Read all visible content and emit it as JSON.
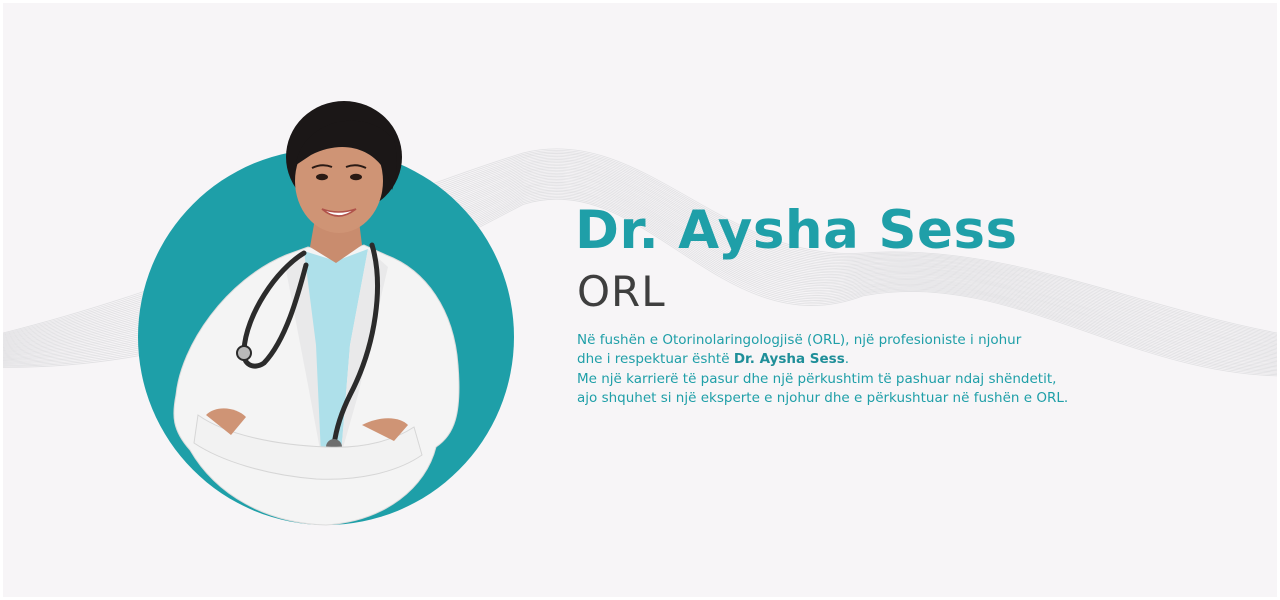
{
  "colors": {
    "accent": "#1f9fa8",
    "circle": "#1e9fa8",
    "specialty_text": "#3f3f3f",
    "background": "#f7f5f7"
  },
  "profile": {
    "name": "Dr. Aysha Sess",
    "specialty": "ORL",
    "photo_alt": "doctor-portrait"
  },
  "bio": {
    "line1": "Në fushën e Otorinolaringologjisë (ORL), një profesioniste i njohur",
    "line2_prefix": "dhe i respektuar është ",
    "line2_bold": "Dr. Aysha Sess",
    "line2_suffix": ".",
    "line3": "Me një karrierë të pasur dhe një përkushtim të pashuar ndaj shëndetit,",
    "line4": "ajo shquhet si një eksperte e njohur dhe e përkushtuar në fushën e ORL."
  }
}
